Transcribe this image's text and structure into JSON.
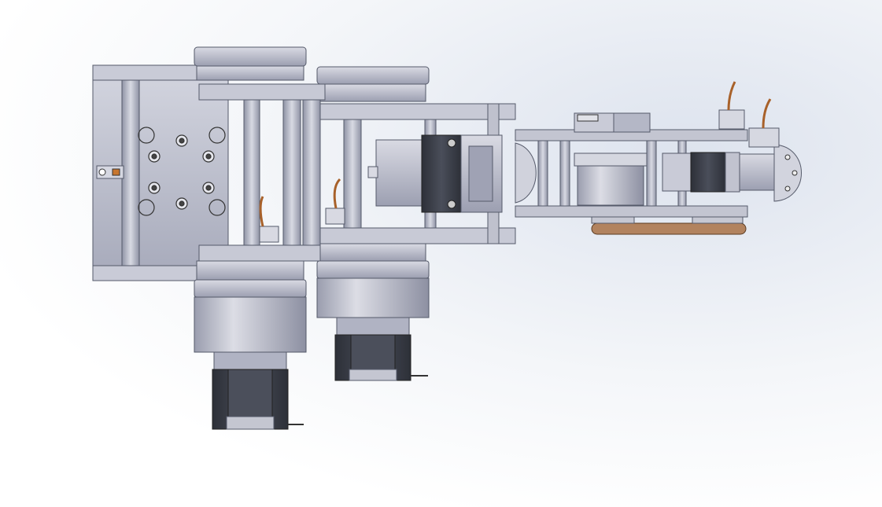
{
  "scene": {
    "background_top": "#e6eaf1",
    "background_bottom": "#ffffff",
    "part_color": "#b9bccb",
    "part_shadow": "#8c90a3",
    "motor_dark": "#3b3e47",
    "wire_color": "#a8612a",
    "belt_color": "#b2835f"
  }
}
